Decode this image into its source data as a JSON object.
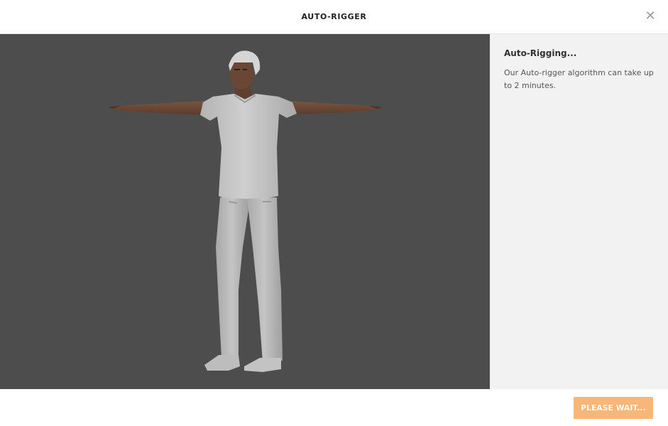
{
  "header": {
    "title": "AUTO-RIGGER",
    "close_icon": "close-icon"
  },
  "panel": {
    "title": "Auto-Rigging...",
    "description": "Our Auto-rigger algorithm can take up to 2 minutes."
  },
  "footer": {
    "button_label": "PLEASE WAIT..."
  },
  "colors": {
    "viewport_bg": "#4d4d4d",
    "panel_bg": "#f2f2f2",
    "button_bg": "#f9b679",
    "skin": "#6e4a35",
    "clothing": "#c9c9c9",
    "hair": "#d9d9d9"
  }
}
